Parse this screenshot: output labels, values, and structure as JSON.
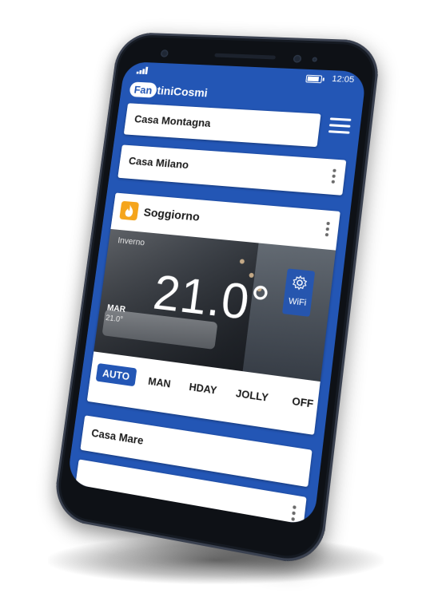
{
  "status_bar": {
    "time": "12:05",
    "signal_icon": "signal-bars-icon",
    "battery_icon": "battery-icon"
  },
  "brand": {
    "logo_badge": "Fan",
    "logo_rest": "tiniCosmi"
  },
  "colors": {
    "primary": "#2356b5",
    "flame": "#f5a51c"
  },
  "homes": [
    {
      "name": "Casa Montagna"
    },
    {
      "name": "Casa Milano"
    },
    {
      "name": "Casa Mare"
    }
  ],
  "room": {
    "name": "Soggiorno",
    "season": "Inverno",
    "temperature": "21.0°",
    "day": "MAR",
    "day_temperature": "21.0°",
    "wifi_label": "WiFi"
  },
  "modes": [
    "AUTO",
    "MAN",
    "HDAY",
    "JOLLY",
    "OFF"
  ],
  "active_mode": "AUTO"
}
